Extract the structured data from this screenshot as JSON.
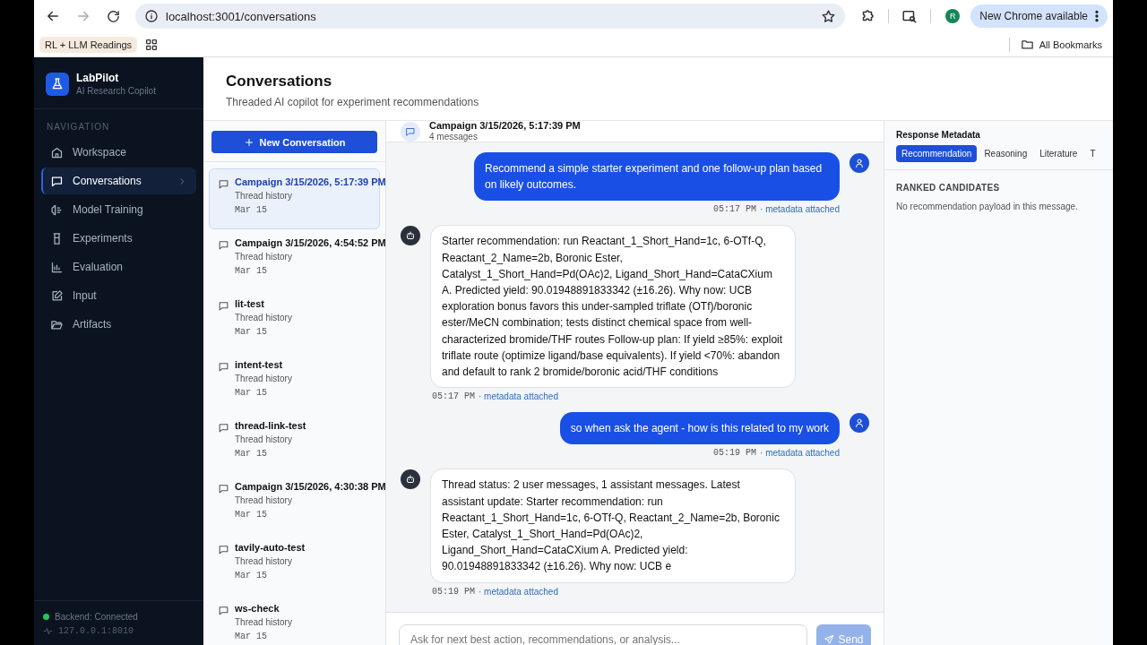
{
  "browser": {
    "url": "localhost:3001/conversations",
    "profile_initial": "R",
    "update_label": "New Chrome available",
    "bookmarks": [
      {
        "label": "RL + LLM Readings"
      }
    ],
    "all_bookmarks": "All Bookmarks"
  },
  "sidebar": {
    "brand": {
      "name": "LabPilot",
      "tagline": "AI Research Copilot"
    },
    "section_label": "NAVIGATION",
    "items": [
      {
        "label": "Workspace",
        "selected": false
      },
      {
        "label": "Conversations",
        "selected": true
      },
      {
        "label": "Model Training",
        "selected": false
      },
      {
        "label": "Experiments",
        "selected": false
      },
      {
        "label": "Evaluation",
        "selected": false
      },
      {
        "label": "Input",
        "selected": false
      },
      {
        "label": "Artifacts",
        "selected": false
      }
    ],
    "status": {
      "label": "Backend: Connected",
      "connected": true,
      "address": "127.0.0.1:8010"
    }
  },
  "header": {
    "title": "Conversations",
    "subtitle": "Threaded AI copilot for experiment recommendations"
  },
  "conversation_list": {
    "new_button": "New Conversation",
    "items": [
      {
        "title": "Campaign 3/15/2026, 5:17:39 PM",
        "subtitle": "Thread history",
        "date": "Mar 15",
        "selected": true
      },
      {
        "title": "Campaign 3/15/2026, 4:54:52 PM",
        "subtitle": "Thread history",
        "date": "Mar 15",
        "selected": false
      },
      {
        "title": "lit-test",
        "subtitle": "Thread history",
        "date": "Mar 15",
        "selected": false
      },
      {
        "title": "intent-test",
        "subtitle": "Thread history",
        "date": "Mar 15",
        "selected": false
      },
      {
        "title": "thread-link-test",
        "subtitle": "Thread history",
        "date": "Mar 15",
        "selected": false
      },
      {
        "title": "Campaign 3/15/2026, 4:30:38 PM",
        "subtitle": "Thread history",
        "date": "Mar 15",
        "selected": false
      },
      {
        "title": "tavily-auto-test",
        "subtitle": "Thread history",
        "date": "Mar 15",
        "selected": false
      },
      {
        "title": "ws-check",
        "subtitle": "Thread history",
        "date": "Mar 15",
        "selected": false
      }
    ]
  },
  "chat": {
    "title": "Campaign 3/15/2026, 5:17:39 PM",
    "count": "4 messages",
    "messages": [
      {
        "kind": "user",
        "text": "Recommend a simple starter experiment and one follow-up plan based on likely outcomes.",
        "time": "05:17 PM",
        "meta": "· metadata attached"
      },
      {
        "kind": "assistant",
        "text": "Starter recommendation: run Reactant_1_Short_Hand=1c, 6-OTf-Q, Reactant_2_Name=2b, Boronic Ester, Catalyst_1_Short_Hand=Pd(OAc)2, Ligand_Short_Hand=CataCXium A. Predicted yield: 90.01948891833342 (±16.26). Why now: UCB exploration bonus favors this under-sampled triflate (OTf)/boronic ester/MeCN combination; tests distinct chemical space from well-characterized bromide/THF routes Follow-up plan: If yield ≥85%: exploit triflate route (optimize ligand/base equivalents). If yield <70%: abandon and default to rank 2 bromide/boronic acid/THF conditions",
        "time": "05:17 PM",
        "meta": "· metadata attached"
      },
      {
        "kind": "user",
        "text": "so when ask the agent - how is this related to my work",
        "time": "05:19 PM",
        "meta": "· metadata attached"
      },
      {
        "kind": "assistant",
        "text": "Thread status: 2 user messages, 1 assistant messages. Latest assistant update: Starter recommendation: run Reactant_1_Short_Hand=1c, 6-OTf-Q, Reactant_2_Name=2b, Boronic Ester, Catalyst_1_Short_Hand=Pd(OAc)2, Ligand_Short_Hand=CataCXium A. Predicted yield: 90.01948891833342 (±16.26). Why now: UCB e",
        "time": "05:19 PM",
        "meta": "· metadata attached"
      }
    ]
  },
  "composer": {
    "placeholder": "Ask for next best action, recommendations, or analysis...",
    "send_label": "Send",
    "disabled": true
  },
  "metadata": {
    "title": "Response Metadata",
    "tabs": [
      {
        "label": "Recommendation",
        "selected": true
      },
      {
        "label": "Reasoning",
        "selected": false
      },
      {
        "label": "Literature",
        "selected": false
      },
      {
        "label": "T",
        "selected": false
      }
    ],
    "section_label": "RANKED CANDIDATES",
    "empty_text": "No recommendation payload in this message."
  }
}
